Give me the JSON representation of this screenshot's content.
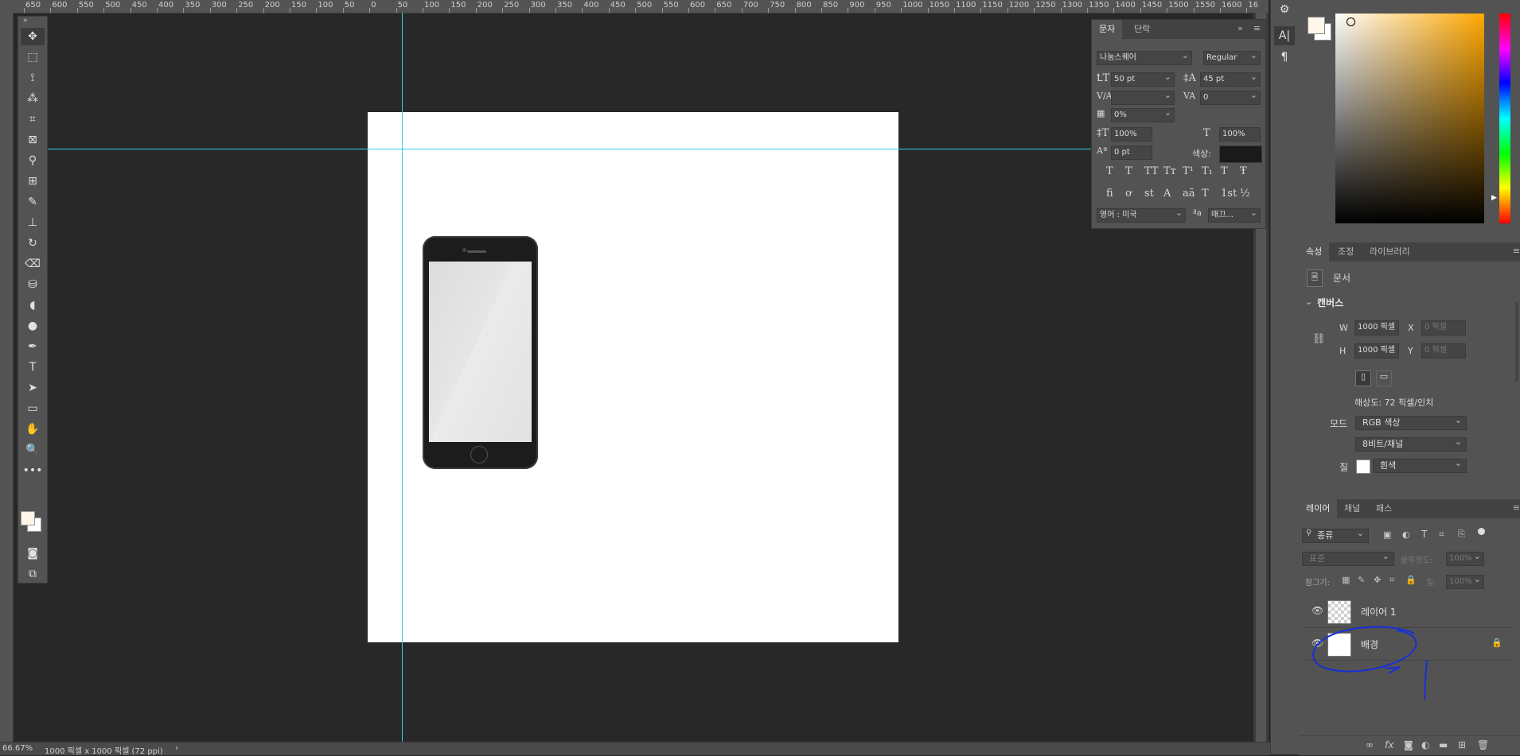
{
  "ruler": {
    "labels": [
      "650",
      "600",
      "550",
      "500",
      "450",
      "400",
      "350",
      "300",
      "250",
      "200",
      "150",
      "100",
      "50",
      "0",
      "50",
      "100",
      "150",
      "200",
      "250",
      "300",
      "350",
      "400",
      "450",
      "500",
      "550",
      "600",
      "650",
      "700",
      "750",
      "800",
      "850",
      "900",
      "950",
      "1000",
      "1050",
      "1100",
      "1150",
      "1200",
      "1250",
      "1300",
      "1350",
      "1400",
      "1450",
      "1500",
      "1550",
      "1600",
      "16"
    ]
  },
  "toolbar": {
    "tools": [
      {
        "name": "move-tool-icon",
        "glyph": "✥"
      },
      {
        "name": "marquee-tool-icon",
        "glyph": "⬚"
      },
      {
        "name": "lasso-tool-icon",
        "glyph": "⟟"
      },
      {
        "name": "magic-wand-tool-icon",
        "glyph": "⁂"
      },
      {
        "name": "crop-tool-icon",
        "glyph": "⌗"
      },
      {
        "name": "frame-tool-icon",
        "glyph": "⊠"
      },
      {
        "name": "eyedropper-tool-icon",
        "glyph": "⚲"
      },
      {
        "name": "healing-brush-tool-icon",
        "glyph": "⊞"
      },
      {
        "name": "brush-tool-icon",
        "glyph": "✎"
      },
      {
        "name": "stamp-tool-icon",
        "glyph": "⊥"
      },
      {
        "name": "history-brush-tool-icon",
        "glyph": "↻"
      },
      {
        "name": "eraser-tool-icon",
        "glyph": "⌫"
      },
      {
        "name": "paint-bucket-tool-icon",
        "glyph": "⛁"
      },
      {
        "name": "blur-tool-icon",
        "glyph": "◖"
      },
      {
        "name": "dodge-tool-icon",
        "glyph": "●"
      },
      {
        "name": "pen-tool-icon",
        "glyph": "✒"
      },
      {
        "name": "type-tool-icon",
        "glyph": "T"
      },
      {
        "name": "path-selection-tool-icon",
        "glyph": "➤"
      },
      {
        "name": "rectangle-tool-icon",
        "glyph": "▭"
      },
      {
        "name": "hand-tool-icon",
        "glyph": "✋"
      },
      {
        "name": "zoom-tool-icon",
        "glyph": "🔍"
      },
      {
        "name": "more-tools-icon",
        "glyph": "•••"
      }
    ]
  },
  "status": {
    "zoom": "66.67%",
    "doc_info": "1000 픽셀 x 1000 픽셀 (72 ppi)",
    "arrow": "›"
  },
  "character": {
    "tabs": [
      "문자",
      "단락"
    ],
    "font_family": "나눔스퀘어",
    "font_style": "Regular",
    "font_size": "50 pt",
    "leading": "45 pt",
    "kerning": "",
    "tracking": "0",
    "tsume": "0%",
    "vscale": "100%",
    "hscale": "100%",
    "baseline": "0 pt",
    "color_label": "색상:",
    "style_glyphs": [
      "T",
      "T",
      "TT",
      "Tт",
      "T¹",
      "T₁",
      "T",
      "Ŧ"
    ],
    "ot_glyphs": [
      "fi",
      "ơ",
      "st",
      "A",
      "aā",
      "T",
      "1st",
      "½"
    ],
    "language": "영어 : 미국",
    "aa_label": "ªa",
    "antialias": "매끄..."
  },
  "properties": {
    "tabs": [
      "속성",
      "조정",
      "라이브러리"
    ],
    "doc_label": "문서",
    "canvas_title": "캔버스",
    "w_label": "W",
    "w_value": "1000 픽셀",
    "h_label": "H",
    "h_value": "1000 픽셀",
    "x_label": "X",
    "x_placeholder": "0 픽셀",
    "y_label": "Y",
    "y_placeholder": "0 픽셀",
    "resolution": "해상도: 72 픽셀/인치",
    "mode_label": "모드",
    "mode_value": "RGB 색상",
    "bits_value": "8비트/채널",
    "fill_label": "칠",
    "fill_value": "흰색"
  },
  "layers": {
    "tabs": [
      "레이어",
      "채널",
      "패스"
    ],
    "filter": "종류",
    "blend": "표준",
    "opacity_label": "불투명도:",
    "opacity_value": "100%",
    "lock_label": "잠그기:",
    "fill_label": "칠:",
    "fill_value": "100%",
    "items": [
      {
        "name": "레이어 1",
        "thumb": "check",
        "locked": false
      },
      {
        "name": "배경",
        "thumb": "white",
        "locked": true
      }
    ]
  },
  "colors": {
    "guide": "#30d0e6",
    "annotation": "#1a2fd6",
    "foreground": "#fff7ea",
    "background": "#ffffff"
  }
}
